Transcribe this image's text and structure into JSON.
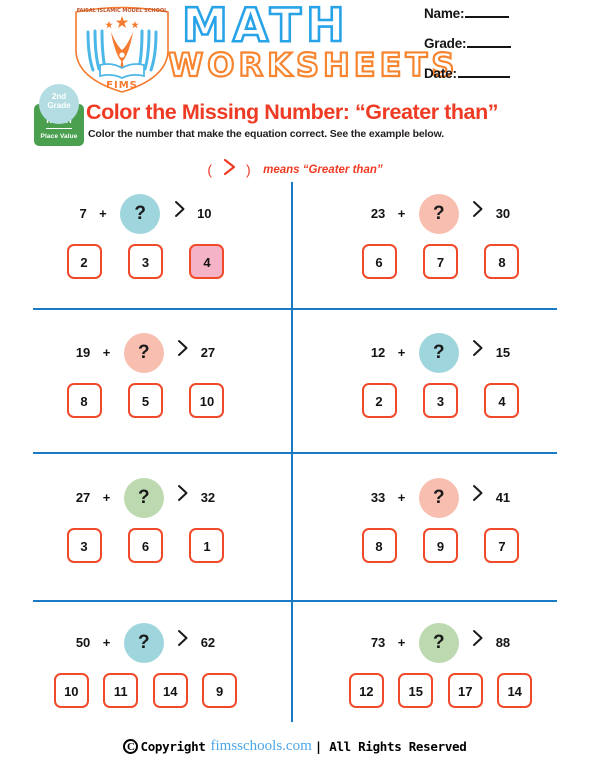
{
  "header": {
    "logo": {
      "school_name": "FAISAL ISLAMIC MODEL SCHOOL",
      "acronym": "FIMS"
    },
    "wordmark": {
      "line1": "MATH",
      "line2": "WORKSHEETS"
    },
    "fields": [
      {
        "label": "Name:"
      },
      {
        "label": "Grade:"
      },
      {
        "label": "Date:"
      }
    ]
  },
  "badge": {
    "grade_line1": "2nd",
    "grade_line2": "Grade",
    "subject": "Math",
    "topic": "Place Value"
  },
  "title": "Color the Missing Number: “Greater than”",
  "subtitle": "Color the number that make the equation correct.  See the example below.",
  "legend": {
    "open_paren": "(",
    "close_paren": ")",
    "symbol": "greater-than",
    "text": "means  “Greater than”"
  },
  "colors": {
    "title_red": "#ef3b23",
    "grid_blue": "#1b7ac4",
    "option_border": "#f04a2a",
    "circle_teal": "#9fd5dc",
    "circle_pink": "#f8bfb0",
    "circle_green": "#bcd9b0",
    "colored_fill": "#f4b3c6",
    "badge_green": "#4aa04f",
    "badge_blue": "#b3dde3",
    "wordmark_blue": "#29a3e8",
    "wordmark_orange": "#f7852f",
    "link_blue": "#4da6e8"
  },
  "problems": [
    {
      "left": {
        "first": "7",
        "plus": "+",
        "question": "?",
        "circle": "teal",
        "op": ">",
        "result": "10",
        "options": [
          {
            "value": "2",
            "colored": false
          },
          {
            "value": "3",
            "colored": false
          },
          {
            "value": "4",
            "colored": true
          }
        ]
      },
      "right": {
        "first": "23",
        "plus": "+",
        "question": "?",
        "circle": "pink",
        "op": ">",
        "result": "30",
        "options": [
          {
            "value": "6",
            "colored": false
          },
          {
            "value": "7",
            "colored": false
          },
          {
            "value": "8",
            "colored": false
          }
        ]
      }
    },
    {
      "left": {
        "first": "19",
        "plus": "+",
        "question": "?",
        "circle": "pink",
        "op": ">",
        "result": "27",
        "options": [
          {
            "value": "8",
            "colored": false
          },
          {
            "value": "5",
            "colored": false
          },
          {
            "value": "10",
            "colored": false
          }
        ]
      },
      "right": {
        "first": "12",
        "plus": "+",
        "question": "?",
        "circle": "teal",
        "op": ">",
        "result": "15",
        "options": [
          {
            "value": "2",
            "colored": false
          },
          {
            "value": "3",
            "colored": false
          },
          {
            "value": "4",
            "colored": false
          }
        ]
      }
    },
    {
      "left": {
        "first": "27",
        "plus": "+",
        "question": "?",
        "circle": "green",
        "op": ">",
        "result": "32",
        "options": [
          {
            "value": "3",
            "colored": false
          },
          {
            "value": "6",
            "colored": false
          },
          {
            "value": "1",
            "colored": false
          }
        ]
      },
      "right": {
        "first": "33",
        "plus": "+",
        "question": "?",
        "circle": "pink",
        "op": ">",
        "result": "41",
        "options": [
          {
            "value": "8",
            "colored": false
          },
          {
            "value": "9",
            "colored": false
          },
          {
            "value": "7",
            "colored": false
          }
        ]
      }
    },
    {
      "left": {
        "first": "50",
        "plus": "+",
        "question": "?",
        "circle": "teal",
        "op": ">",
        "result": "62",
        "options": [
          {
            "value": "10",
            "colored": false
          },
          {
            "value": "11",
            "colored": false
          },
          {
            "value": "14",
            "colored": false
          },
          {
            "value": "9",
            "colored": false
          }
        ]
      },
      "right": {
        "first": "73",
        "plus": "+",
        "question": "?",
        "circle": "green",
        "op": ">",
        "result": "88",
        "options": [
          {
            "value": "12",
            "colored": false
          },
          {
            "value": "15",
            "colored": false
          },
          {
            "value": "17",
            "colored": false
          },
          {
            "value": "14",
            "colored": false
          }
        ]
      }
    }
  ],
  "footer": {
    "symbol": "C",
    "copyright": "Copyright",
    "site": "fimsschools.com",
    "rights": "| All Rights Reserved"
  }
}
